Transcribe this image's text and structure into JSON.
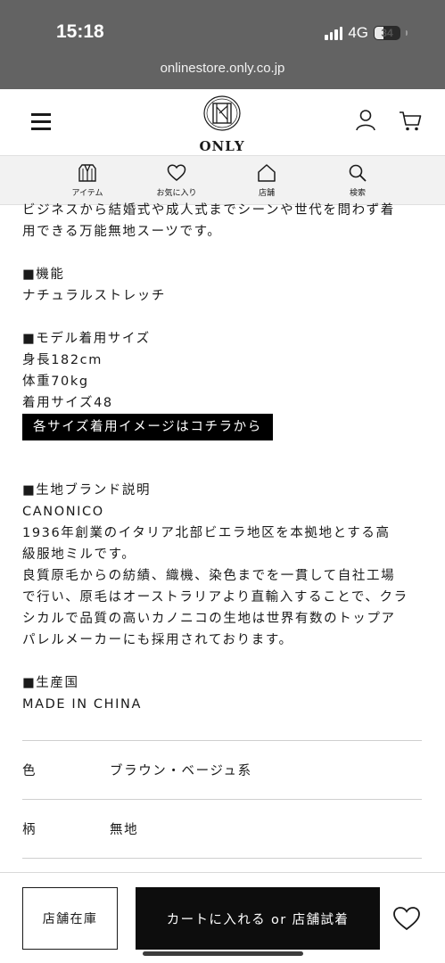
{
  "status_bar": {
    "time": "15:18",
    "network": "4G",
    "battery": "34",
    "battery_level": 0.34,
    "url": "onlinestore.only.co.jp"
  },
  "header": {
    "logo_text": "ONLY",
    "menu_icon": "hamburger-icon",
    "account_icon": "user-icon",
    "cart_icon": "cart-icon"
  },
  "nav": {
    "items": [
      {
        "icon": "jacket-icon",
        "label": "アイテム"
      },
      {
        "icon": "heart-icon",
        "label": "お気に入り"
      },
      {
        "icon": "store-icon",
        "label": "店舗"
      },
      {
        "icon": "search-icon",
        "label": "検索"
      }
    ]
  },
  "description": {
    "intro_line1": "ビジネスから結婚式や成人式までシーンや世代を問わず着",
    "intro_line2": "用できる万能無地スーツです。",
    "function_heading": "■機能",
    "function_text": "ナチュラルストレッチ",
    "model_heading": "■モデル着用サイズ",
    "model_height": "身長182cm",
    "model_weight": "体重70kg",
    "model_size": "着用サイズ48",
    "size_link": "各サイズ着用イメージはコチラから",
    "fabric_heading": "■生地ブランド説明",
    "fabric_brand": "CANONICO",
    "fabric_lines": [
      "1936年創業のイタリア北部ビエラ地区を本拠地とする高",
      "級服地ミルです。",
      "良質原毛からの紡績、織機、染色までを一貫して自社工場",
      "で行い、原毛はオーストラリアより直輸入することで、クラ",
      "シカルで品質の高いカノニコの生地は世界有数のトップア",
      "パレルメーカーにも採用されております。"
    ],
    "origin_heading": "■生産国",
    "origin_text": "MADE IN CHINA"
  },
  "specs": [
    {
      "label": "色",
      "value": "ブラウン・ベージュ系"
    },
    {
      "label": "柄",
      "value": "無地"
    }
  ],
  "bottom": {
    "store_stock": "店舗在庫",
    "cart_button": "カートに入れる or 店舗試着",
    "favorite_icon": "heart-icon"
  }
}
